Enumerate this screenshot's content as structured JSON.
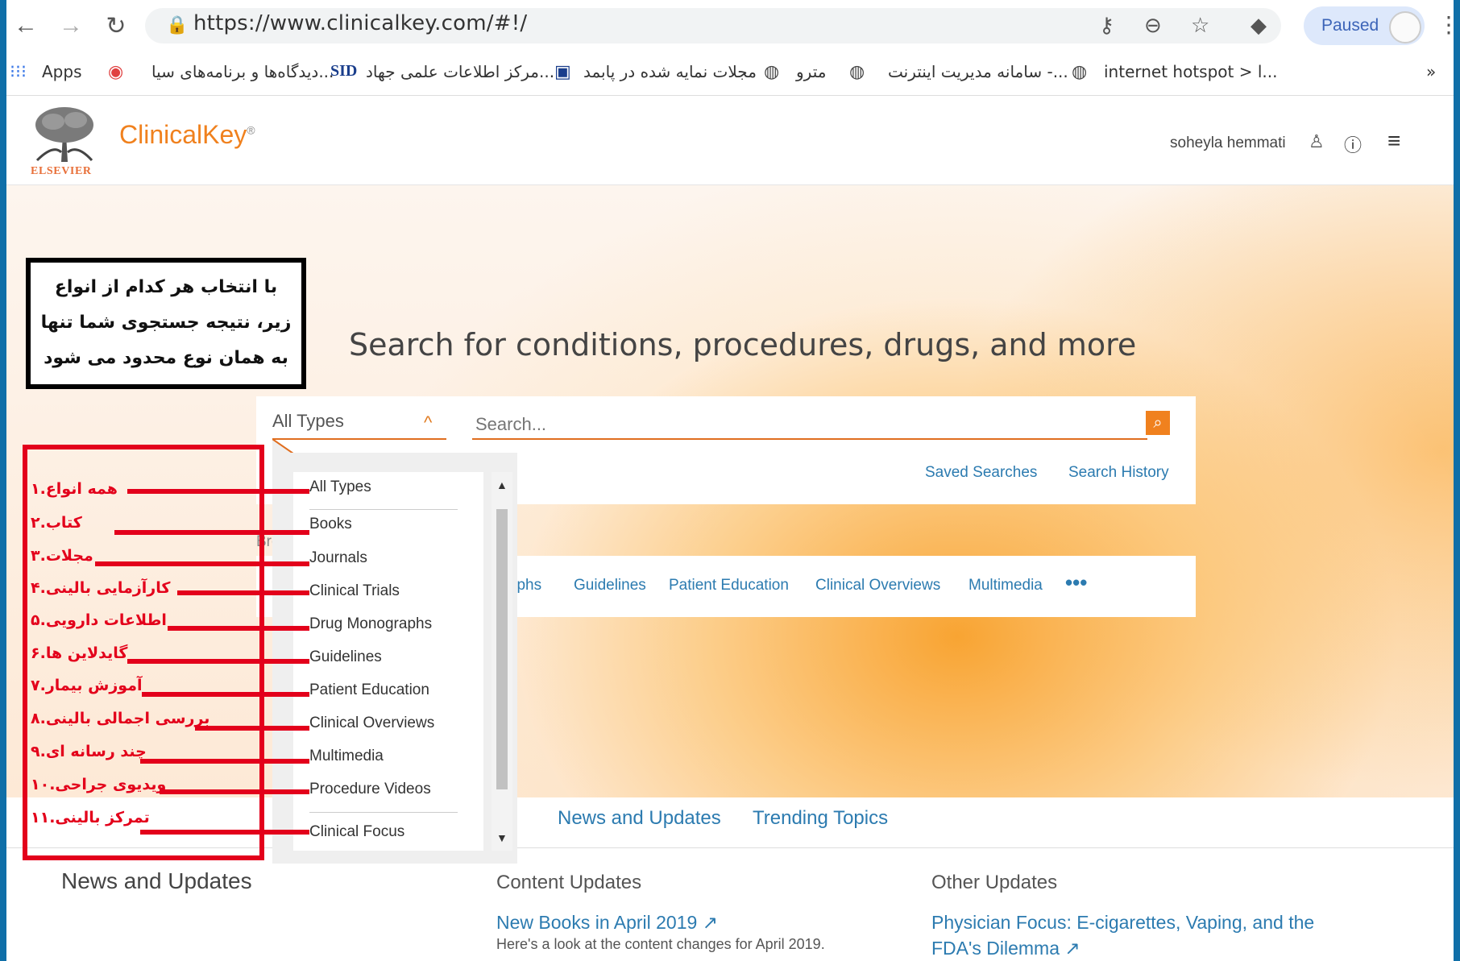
{
  "browser": {
    "url": "https://www.clinicalkey.com/#!/",
    "paused_label": "Paused",
    "bookmarks": {
      "apps": "Apps",
      "b1": "دیدگاه‌ها و برنامه‌های سیا...",
      "b2_prefix": "SID",
      "b2": "مرکز اطلاعات علمی جهاد...",
      "b3": "مجلات نمایه شده در پابمد",
      "b4": "مترو",
      "b5": "سامانه مدیریت اینترنت -...",
      "b6": "internet hotspot > l...",
      "more": "»"
    }
  },
  "site": {
    "brand": "ClinicalKey",
    "brand_mark": "®",
    "publisher": "ELSEVIER",
    "user_name": "soheyla hemmati"
  },
  "hero": {
    "title": "Search for conditions, procedures, drugs, and more"
  },
  "search": {
    "type_value": "All Types",
    "placeholder": "Search...",
    "saved_searches": "Saved Searches",
    "search_history": "Search History"
  },
  "browse": {
    "partial_label": "Brov",
    "links": [
      "graphs",
      "Guidelines",
      "Patient Education",
      "Clinical Overviews",
      "Multimedia"
    ],
    "more": "•••"
  },
  "dropdown": {
    "options": [
      "All Types",
      "Books",
      "Journals",
      "Clinical Trials",
      "Drug Monographs",
      "Guidelines",
      "Patient Education",
      "Clinical Overviews",
      "Multimedia",
      "Procedure Videos",
      "Clinical Focus"
    ]
  },
  "tabs": {
    "news": "News and Updates",
    "trending": "Trending Topics"
  },
  "news": {
    "section_title": "News and Updates",
    "content_updates": "Content Updates",
    "other_updates": "Other Updates",
    "content_link": "New Books in April 2019",
    "content_desc": "Here's a look at the content changes for April 2019.",
    "other_link_1": "Physician Focus: E-cigarettes, Vaping, and the",
    "other_link_2": "FDA's Dilemma"
  },
  "annotation": {
    "note_lines": [
      "با انتخاب هر کدام از انواع",
      "زیر، نتیجه جستجوی شما تنها",
      "به همان نوع محدود می شود"
    ],
    "labels": [
      "همه انواع.۱",
      "کتاب.۲",
      "مجلات.۳",
      "کارآزمایی بالینی.۴",
      "اطلاعات دارویی.۵",
      "گایدلاین ها.۶",
      "آموزش بیمار.۷",
      "بررسی اجمالی بالینی.۸",
      "چند رسانه ای.۹",
      "ویدیوی جراحی.۱۰",
      "تمرکز بالینی.۱۱"
    ]
  },
  "colors": {
    "accent": "#f0811e",
    "link": "#2c7bb0",
    "annotation_red": "#e3001b"
  }
}
